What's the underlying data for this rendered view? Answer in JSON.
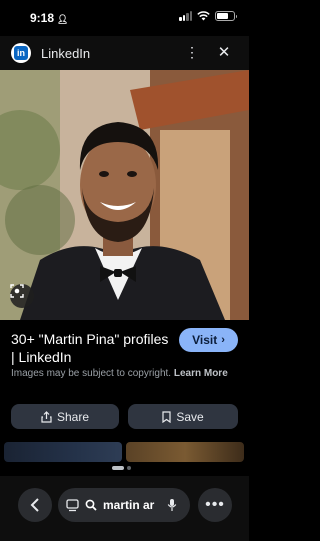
{
  "status": {
    "time": "9:18"
  },
  "header": {
    "site_name": "LinkedIn",
    "logo_letters": "in"
  },
  "result": {
    "title": "30+ \"Martin Pina\" profiles | LinkedIn",
    "visit_label": "Visit",
    "copyright_notice": "Images may be subject to copyright.",
    "learn_more_label": "Learn More"
  },
  "actions": {
    "share_label": "Share",
    "save_label": "Save"
  },
  "search": {
    "query": "martin ar"
  },
  "icons": {
    "status": [
      "person-icon",
      "signal-icon",
      "wifi-icon",
      "battery-icon"
    ],
    "header": [
      "linkedin-logo-icon",
      "more-vert-icon",
      "close-icon"
    ],
    "bottom": [
      "back-chevron-icon",
      "tabs-icon",
      "search-icon",
      "mic-icon",
      "more-horiz-icon"
    ]
  },
  "colors": {
    "visit_button": "#8ab4f8",
    "linkedin_blue": "#0a66c2",
    "pill_bg": "#2f3540"
  }
}
